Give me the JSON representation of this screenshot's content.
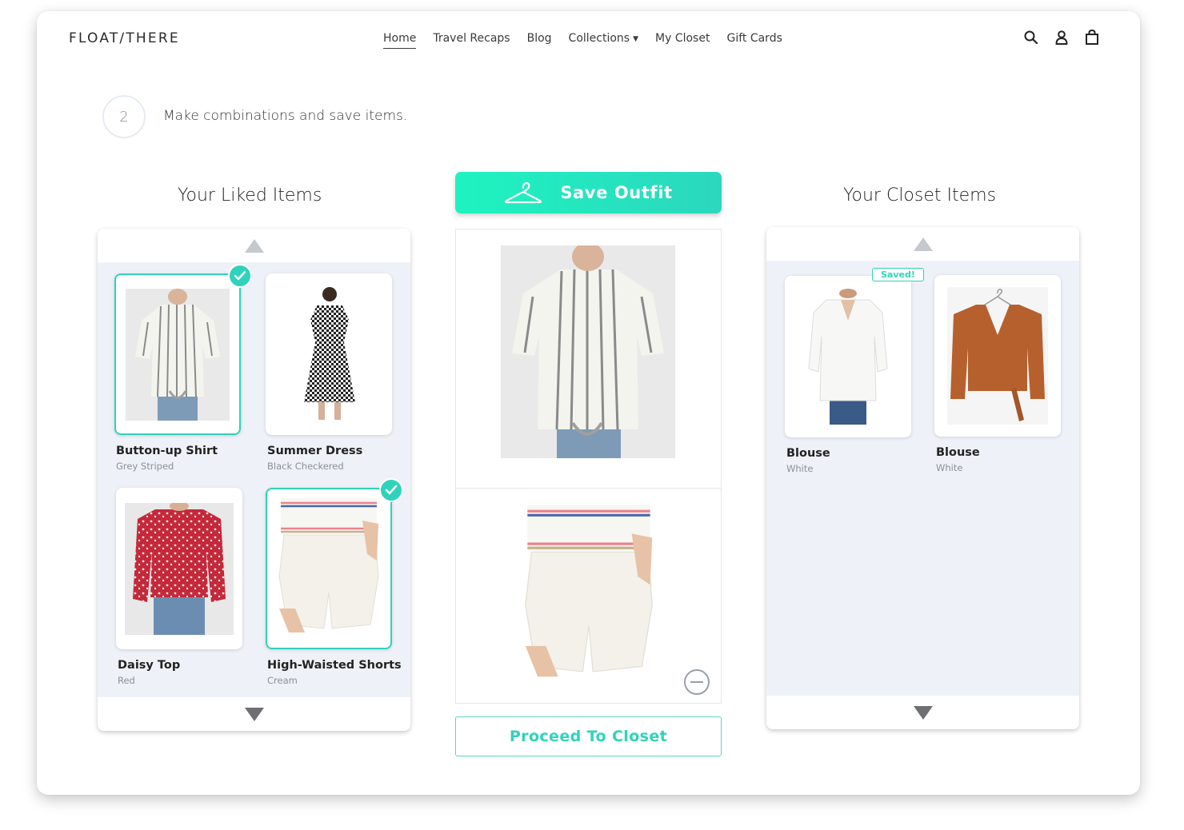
{
  "brand": {
    "logo": "FLOAT/THERE",
    "accent": "#2fd3bb"
  },
  "nav": {
    "items": [
      "Home",
      "Travel Recaps",
      "Blog",
      "Collections",
      "My Closet",
      "Gift Cards"
    ],
    "active": "Home"
  },
  "header_icons": [
    "search-icon",
    "account-icon",
    "cart-icon"
  ],
  "step": {
    "number": "2",
    "text": "Make combinations and save items."
  },
  "liked": {
    "title": "Your Liked Items",
    "items": [
      {
        "name": "Button-up Shirt",
        "sub": "Grey Striped",
        "selected": true
      },
      {
        "name": "Summer Dress",
        "sub": "Black Checkered",
        "selected": false
      },
      {
        "name": "Daisy Top",
        "sub": "Red",
        "selected": false
      },
      {
        "name": "High-Waisted Shorts",
        "sub": "Cream",
        "selected": true
      }
    ]
  },
  "outfit": {
    "save_label": "Save Outfit",
    "proceed_label": "Proceed To Closet"
  },
  "closet": {
    "title": "Your Closet Items",
    "saved_badge": "Saved!",
    "items": [
      {
        "name": "Blouse",
        "sub": "White"
      },
      {
        "name": "Blouse",
        "sub": "White"
      }
    ]
  }
}
